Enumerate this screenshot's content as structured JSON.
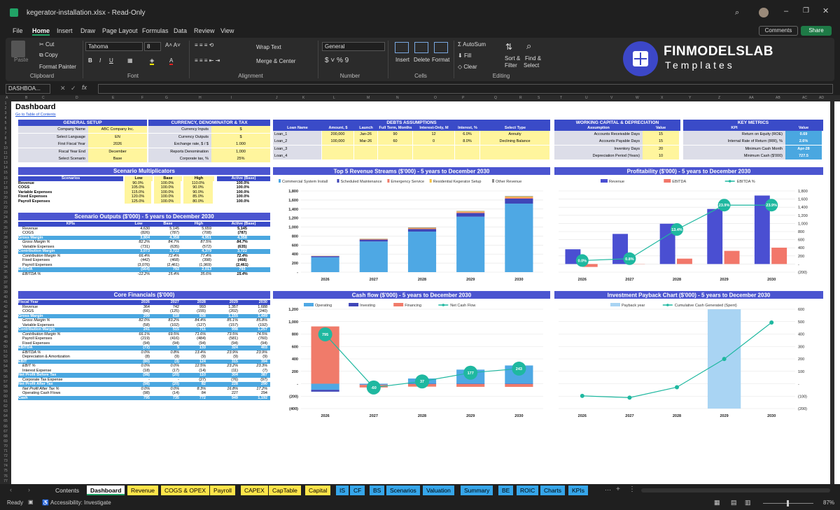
{
  "window": {
    "title": "kegerator-installation.xlsx  -  Read-Only"
  },
  "menu": [
    "File",
    "Home",
    "Insert",
    "Draw",
    "Page Layout",
    "Formulas",
    "Data",
    "Review",
    "View"
  ],
  "menu_right": {
    "comments": "Comments",
    "share": "Share"
  },
  "ribbon": {
    "paste": "Paste",
    "cut": "Cut",
    "copy": "Copy",
    "format_painter": "Format Painter",
    "clipboard": "Clipboard",
    "font_name": "Tahoma",
    "font_size": "8",
    "font": "Font",
    "wrap": "Wrap Text",
    "merge": "Merge & Center",
    "alignment": "Alignment",
    "number_format": "General",
    "number": "Number",
    "insert": "Insert",
    "delete": "Delete",
    "format": "Format",
    "cells": "Cells",
    "autosum": "AutoSum",
    "fill": "Fill",
    "clear": "Clear",
    "sort": "Sort &",
    "filter": "Filter",
    "find": "Find &",
    "select": "Select",
    "editing": "Editing"
  },
  "brand": {
    "name": "FINMODELSLAB",
    "tagline": "Templates"
  },
  "formula": {
    "namebox": "DASHBOA...",
    "fx": "fx"
  },
  "columns": [
    "A",
    "B",
    "C",
    "D",
    "E",
    "F",
    "G",
    "H",
    "I",
    "J",
    "K",
    "L",
    "M",
    "N",
    "O",
    "P",
    "Q",
    "R",
    "S",
    "T",
    "U",
    "V",
    "W",
    "X",
    "Y",
    "Z",
    "AA",
    "AB",
    "AC",
    "AD"
  ],
  "dashboard": {
    "title": "Dashboard",
    "link": "Go to Table of Contents"
  },
  "general": {
    "title": "GENERAL SETUP",
    "rows": [
      [
        "Company Name",
        "ABC Company Inc."
      ],
      [
        "Select Language",
        "EN"
      ],
      [
        "First Fiscal Year",
        "2026"
      ],
      [
        "Fiscal Year End",
        "December"
      ],
      [
        "Select Scenario",
        "Base"
      ]
    ]
  },
  "currency": {
    "title": "CURRENCY, DENOMINATOR & TAX",
    "rows": [
      [
        "Currency Inputs",
        "$"
      ],
      [
        "Currency Outputs",
        "$"
      ],
      [
        "Exchange rate, $ / $",
        "1.000"
      ],
      [
        "Reports Denomination",
        "1,000"
      ],
      [
        "Corporate tax, %",
        "25%"
      ]
    ]
  },
  "debts": {
    "title": "DEBTS ASSUMPTIONS",
    "headers": [
      "Loan Name",
      "Amount, $",
      "Launch",
      "Full Term, Months",
      "Interest-Only, M",
      "Interest, %",
      "Select Type"
    ],
    "rows": [
      [
        "Loan_1",
        "200,000",
        "Jan-26",
        "90",
        "12",
        "6.0%",
        "Annuity"
      ],
      [
        "Loan_2",
        "100,000",
        "Mar-26",
        "60",
        "0",
        "8.0%",
        "Declining Balance"
      ],
      [
        "Loan_3",
        "",
        "",
        "",
        "",
        "",
        ""
      ],
      [
        "Loan_4",
        "",
        "",
        "",
        "",
        "",
        ""
      ]
    ]
  },
  "wc": {
    "title": "WORKING CAPITAL & DEPRECIATION",
    "headers": [
      "Assumption",
      "Value"
    ],
    "rows": [
      [
        "Accounts Receivable Days",
        "15"
      ],
      [
        "Accounts Payable Days",
        "15"
      ],
      [
        "Inventory Days",
        "20"
      ],
      [
        "Depreciation Period (Years)",
        "10"
      ]
    ]
  },
  "kpi": {
    "title": "KEY METRICS",
    "headers": [
      "KPI",
      "Value"
    ],
    "rows": [
      [
        "Return on Equity (ROE)",
        "0.69"
      ],
      [
        "Internal Rate of Return (IRR), %",
        "2.6%"
      ],
      [
        "Minimum Cash Month",
        "Apr-28"
      ],
      [
        "Minimum Cash ($'000)",
        "727.5"
      ]
    ]
  },
  "multipliers": {
    "title": "Scenario Multiplicators",
    "headers": [
      "Scenarios",
      "Low",
      "Base",
      "High",
      "Active (Base)"
    ],
    "rows": [
      [
        "Revenue",
        "90.0%",
        "100.0%",
        "110.0%",
        "100.0%"
      ],
      [
        "COGS",
        "105.0%",
        "100.0%",
        "90.0%",
        "100.0%"
      ],
      [
        "Variable Expenses",
        "115.0%",
        "100.0%",
        "90.0%",
        "100.0%"
      ],
      [
        "Fixed Expenses",
        "120.0%",
        "100.0%",
        "85.0%",
        "100.0%"
      ],
      [
        "Payroll Expenses",
        "125.0%",
        "100.0%",
        "80.0%",
        "100.0%"
      ]
    ]
  },
  "outputs": {
    "title": "Scenario Outputs ($'000) - 5 years to December 2030",
    "headers": [
      "KPIs",
      "Low",
      "Base",
      "High",
      "Active (Base)"
    ],
    "rows": [
      [
        "Revenue",
        "4,630",
        "5,145",
        "5,659",
        "5,145",
        ""
      ],
      [
        "COGS",
        "(826)",
        "(787)",
        "(708)",
        "(787)",
        ""
      ],
      [
        "Gross Margin",
        "3,804",
        "4,358",
        "4,951",
        "4,358",
        "h"
      ],
      [
        "Gross Margin %",
        "82.2%",
        "84.7%",
        "87.5%",
        "84.7%",
        "i"
      ],
      [
        "Variable Expenses",
        "(731)",
        "(635)",
        "(572)",
        "(635)",
        ""
      ],
      [
        "Contribution Margin",
        "3,073",
        "3,722",
        "4,379",
        "3,722",
        "h"
      ],
      [
        "Contribution Margin %",
        "66.4%",
        "72.4%",
        "77.4%",
        "72.4%",
        "i"
      ],
      [
        "Fixed Expenses",
        "(442)",
        "(468)",
        "(398)",
        "(468)",
        ""
      ],
      [
        "Payroll Expenses",
        "(3,076)",
        "(2,461)",
        "(1,969)",
        "(2,461)",
        ""
      ],
      [
        "EBITDA",
        "(564)",
        "793",
        "2,013",
        "793",
        "h"
      ],
      [
        "EBITDA %",
        "-12.2%",
        "15.4%",
        "35.6%",
        "15.4%",
        "i"
      ]
    ]
  },
  "core": {
    "title": "Core Financials ($'000)",
    "headers": [
      "Fiscal Year",
      "2026",
      "2027",
      "2028",
      "2029",
      "2030"
    ],
    "rows": [
      [
        "Revenue",
        "364",
        "742",
        "993",
        "1,357",
        "1,688",
        ""
      ],
      [
        "COGS",
        "(66)",
        "(125)",
        "(155)",
        "(202)",
        "(240)",
        ""
      ],
      [
        "Gross Margin",
        "299",
        "618",
        "838",
        "1,155",
        "1,449",
        "h"
      ],
      [
        "Gross Margin %",
        "82.0%",
        "83.2%",
        "84.4%",
        "85.1%",
        "85.8%",
        "i"
      ],
      [
        "Variable Expenses",
        "(58)",
        "(102)",
        "(127)",
        "(157)",
        "(192)",
        ""
      ],
      [
        "Contribution Margin",
        "241",
        "515",
        "711",
        "998",
        "1,257",
        "h"
      ],
      [
        "Contribution Margin %",
        "66.1%",
        "69.5%",
        "71.6%",
        "73.5%",
        "74.5%",
        "i"
      ],
      [
        "Payroll Expenses",
        "(219)",
        "(416)",
        "(484)",
        "(581)",
        "(760)",
        ""
      ],
      [
        "Fixed Expenses",
        "(94)",
        "(94)",
        "(94)",
        "(94)",
        "(94)",
        ""
      ],
      [
        "EBITDA",
        "(72)",
        "5",
        "133",
        "324",
        "403",
        "h"
      ],
      [
        "EBITDA %",
        "0.0%",
        "0.8%",
        "13.4%",
        "23.9%",
        "23.9%",
        "i"
      ],
      [
        "Depreciation & Amortization",
        "(8)",
        "(9)",
        "(9)",
        "(9)",
        "(9)",
        ""
      ],
      [
        "EBIT",
        "(80)",
        "(3)",
        "124",
        "315",
        "394",
        "h"
      ],
      [
        "EBIT %",
        "0.0%",
        "0.0%",
        "12.5%",
        "23.2%",
        "23.3%",
        "i"
      ],
      [
        "Interest Expense",
        "(18)",
        "(17)",
        "(14)",
        "(11)",
        "(7)",
        ""
      ],
      [
        "Net Profit Before Tax",
        "(98)",
        "(20)",
        "110",
        "304",
        "387",
        "h"
      ],
      [
        "Corporate Tax Expense",
        "-",
        "-",
        "(27)",
        "(76)",
        "(97)",
        ""
      ],
      [
        "Net Profit After Tax",
        "(98)",
        "(20)",
        "82",
        "228",
        "290",
        "h"
      ],
      [
        "Net Profit After Tax %",
        "0.0%",
        "0.0%",
        "8.3%",
        "16.8%",
        "17.2%",
        "i"
      ],
      [
        "Operating Cash Flows",
        "(98)",
        "(14)",
        "84",
        "227",
        "294",
        ""
      ],
      [
        "Cash",
        "795",
        "735",
        "772",
        "949",
        "1,192",
        "h"
      ]
    ]
  },
  "tabs": [
    {
      "label": "Contents",
      "color": "#1f1f1f",
      "fg": "#ddd"
    },
    {
      "label": "Dashboard",
      "color": "#ffffff",
      "fg": "#000"
    },
    {
      "label": "Revenue",
      "color": "#ffe54a",
      "fg": "#000"
    },
    {
      "label": "COGS & OPEX",
      "color": "#ffe54a",
      "fg": "#000"
    },
    {
      "label": "Payroll",
      "color": "#ffe54a",
      "fg": "#000"
    },
    {
      "label": "CAPEX",
      "color": "#ffe54a",
      "fg": "#000"
    },
    {
      "label": "CapTable",
      "color": "#ffe54a",
      "fg": "#000"
    },
    {
      "label": "Capital",
      "color": "#ffe54a",
      "fg": "#000"
    },
    {
      "label": "IS",
      "color": "#36a6ea",
      "fg": "#000"
    },
    {
      "label": "CF",
      "color": "#36a6ea",
      "fg": "#000"
    },
    {
      "label": "BS",
      "color": "#36a6ea",
      "fg": "#000"
    },
    {
      "label": "Scenarios",
      "color": "#36a6ea",
      "fg": "#000"
    },
    {
      "label": "Valuation",
      "color": "#36a6ea",
      "fg": "#000"
    },
    {
      "label": "Summary",
      "color": "#36a6ea",
      "fg": "#000"
    },
    {
      "label": "BE",
      "color": "#36a6ea",
      "fg": "#000"
    },
    {
      "label": "ROIC",
      "color": "#36a6ea",
      "fg": "#000"
    },
    {
      "label": "Charts",
      "color": "#36a6ea",
      "fg": "#000"
    },
    {
      "label": "KPIs",
      "color": "#36a6ea",
      "fg": "#000"
    }
  ],
  "status": {
    "ready": "Ready",
    "accessibility": "Accessibility: Investigate",
    "zoom": "87%"
  },
  "chart_data": [
    {
      "type": "bar",
      "stacked": true,
      "title": "Top 5 Revenue Streams ($'000) - 5 years to December 2030",
      "categories": [
        "2026",
        "2027",
        "2028",
        "2029",
        "2030"
      ],
      "ylim": [
        0,
        1800
      ],
      "series": [
        {
          "name": "Commercial System Install",
          "color": "#4ea8e4",
          "values": [
            330,
            680,
            900,
            1230,
            1520
          ]
        },
        {
          "name": "Scheduled Maintenance",
          "color": "#3f46b8",
          "values": [
            25,
            40,
            55,
            80,
            110
          ]
        },
        {
          "name": "Emergency Service",
          "color": "#f07b6a",
          "values": [
            5,
            10,
            15,
            20,
            25
          ]
        },
        {
          "name": "Residential Kegerator Setup",
          "color": "#f5c242",
          "values": [
            3,
            6,
            12,
            18,
            22
          ]
        },
        {
          "name": "Other Revenue",
          "color": "#8c8c8c",
          "values": [
            1,
            6,
            11,
            9,
            11
          ]
        }
      ]
    },
    {
      "type": "bar",
      "title": "Profitability ($'000) - 5 years to December 2030",
      "categories": [
        "2026",
        "2027",
        "2028",
        "2029",
        "2030"
      ],
      "ylim": [
        -200,
        1800
      ],
      "y2lim": [
        -5,
        30
      ],
      "series": [
        {
          "name": "Revenue",
          "color": "#4a4fd2",
          "values": [
            364,
            742,
            993,
            1357,
            1688
          ]
        },
        {
          "name": "EBITDA",
          "color": "#f2776a",
          "values": [
            -72,
            5,
            133,
            324,
            403
          ]
        },
        {
          "name": "EBITDA %",
          "color": "#1fb8a0",
          "type": "line",
          "values": [
            0.0,
            0.8,
            13.4,
            23.9,
            23.9
          ]
        }
      ]
    },
    {
      "type": "bar",
      "stacked": true,
      "title": "Cash flow ($'000) - 5 years to December 2030",
      "categories": [
        "2026",
        "2027",
        "2028",
        "2029",
        "2030"
      ],
      "ylim": [
        -400,
        1200
      ],
      "series": [
        {
          "name": "Operating",
          "color": "#4ea8e4",
          "values": [
            -98,
            -14,
            84,
            227,
            294
          ]
        },
        {
          "name": "Investing",
          "color": "#3f46b8",
          "values": [
            -30,
            -5,
            -5,
            -5,
            -5
          ]
        },
        {
          "name": "Financing",
          "color": "#f07b6a",
          "values": [
            923,
            -41,
            -42,
            -45,
            -46
          ]
        },
        {
          "name": "Net Cash Flow",
          "color": "#1fb8a0",
          "type": "line",
          "values": [
            795,
            -60,
            37,
            177,
            243
          ]
        }
      ]
    },
    {
      "type": "bar",
      "title": "Investment Payback Chart ($'000) - 5 years to December 2030",
      "categories": [
        "2026",
        "2027",
        "2028",
        "2029",
        "2030"
      ],
      "ylim": [
        -200,
        600
      ],
      "series": [
        {
          "name": "Payback year",
          "color": "#a9d4f3",
          "values": [
            0,
            0,
            0,
            1,
            0
          ]
        },
        {
          "name": "Cumulative Cash Generated (Spent)",
          "color": "#1fb8a0",
          "type": "line",
          "values": [
            -98,
            -112,
            -28,
            199,
            493
          ]
        }
      ]
    }
  ]
}
